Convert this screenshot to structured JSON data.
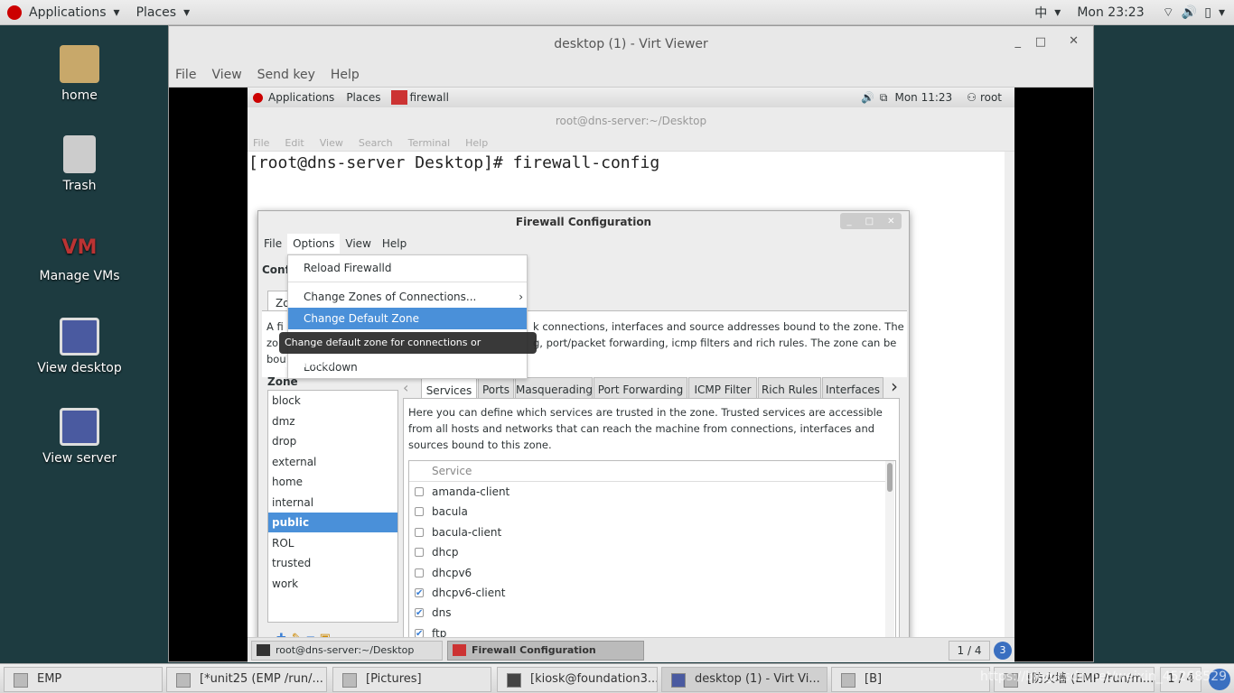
{
  "host_topbar": {
    "applications": "Applications",
    "places": "Places",
    "input_method": "中",
    "clock": "Mon 23:23"
  },
  "desktop_icons": [
    {
      "label": "home"
    },
    {
      "label": "Trash"
    },
    {
      "label": "Manage VMs"
    },
    {
      "label": "View desktop"
    },
    {
      "label": "View server"
    }
  ],
  "virt_viewer": {
    "title": "desktop (1) - Virt Viewer",
    "menu": [
      "File",
      "View",
      "Send key",
      "Help"
    ]
  },
  "guest": {
    "topbar": {
      "applications": "Applications",
      "places": "Places",
      "app": "firewall",
      "clock": "Mon 11:23",
      "user": "root"
    },
    "terminal": {
      "title": "root@dns-server:~/Desktop",
      "menu": [
        "File",
        "Edit",
        "View",
        "Search",
        "Terminal",
        "Help"
      ],
      "line": "[root@dns-server Desktop]# firewall-config"
    },
    "firewall": {
      "title": "Firewall Configuration",
      "menu": [
        "File",
        "Options",
        "View",
        "Help"
      ],
      "options_menu": [
        "Reload Firewalld",
        "Change Zones of Connections...",
        "Change Default Zone",
        "Lockdown"
      ],
      "tooltip": "Change default zone for connections or interfaces.",
      "config_label": "Conf",
      "zones_tab": "Zo",
      "description": [
        "A fi",
        "k connections, interfaces and source addresses bound to the zone. The",
        "zo",
        "g, port/packet forwarding, icmp filters and rich rules. The zone can be",
        "bou"
      ],
      "zone_header": "Zone",
      "zones": [
        "block",
        "dmz",
        "drop",
        "external",
        "home",
        "internal",
        "public",
        "ROL",
        "trusted",
        "work"
      ],
      "selected_zone": "public",
      "tabs": [
        "Services",
        "Ports",
        "Masquerading",
        "Port Forwarding",
        "ICMP Filter",
        "Rich Rules",
        "Interfaces"
      ],
      "active_tab": "Services",
      "services_help": "Here you can define which services are trusted in the zone. Trusted services are accessible from all hosts and networks that can reach the machine from connections, interfaces and sources bound to this zone.",
      "service_header": "Service",
      "services": [
        {
          "name": "amanda-client",
          "checked": false
        },
        {
          "name": "bacula",
          "checked": false
        },
        {
          "name": "bacula-client",
          "checked": false
        },
        {
          "name": "dhcp",
          "checked": false
        },
        {
          "name": "dhcpv6",
          "checked": false
        },
        {
          "name": "dhcpv6-client",
          "checked": true
        },
        {
          "name": "dns",
          "checked": true
        },
        {
          "name": "ftp",
          "checked": true
        }
      ]
    },
    "taskbar": {
      "items": [
        "root@dns-server:~/Desktop",
        "Firewall Configuration"
      ],
      "pager": "1 / 4",
      "badge": "3"
    }
  },
  "host_taskbar": {
    "items": [
      "EMP",
      "[*unit25 (EMP /run/...",
      "[Pictures]",
      "[kiosk@foundation3...",
      "desktop (1) - Virt Vi...",
      "[B]",
      "[防火墙 (EMP /run/m..."
    ],
    "pager": "1 / 4",
    "watermark": "https://blog.csdn.net/weixin_45268529"
  },
  "colors": {
    "accent": "#4a90d9",
    "desktop": "#1d3b40"
  }
}
